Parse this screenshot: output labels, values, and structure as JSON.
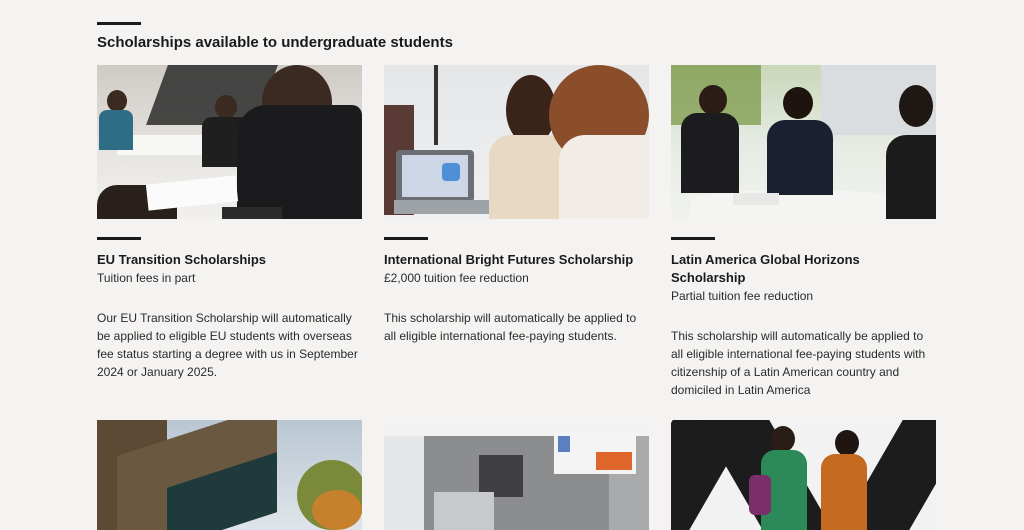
{
  "section": {
    "title": "Scholarships available to undergraduate students"
  },
  "cards": [
    {
      "title": "EU Transition Scholarships",
      "subtitle": "Tuition fees in part",
      "description": "Our EU Transition Scholarship will automatically be applied to eligible EU students with overseas fee status starting a degree with us in September 2024 or January 2025."
    },
    {
      "title": "International Bright Futures Scholarship",
      "subtitle": "£2,000 tuition fee reduction",
      "description": "This scholarship will automatically be applied to all eligible international fee-paying students."
    },
    {
      "title": "Latin America Global Horizons Scholarship",
      "subtitle": "Partial tuition fee reduction",
      "description": "This scholarship will automatically be applied to all eligible international fee-paying students with citizenship of a Latin American country and domiciled in Latin America"
    }
  ],
  "colors": {
    "background": "#f4f3f2",
    "text": "#1a1a1a",
    "rule": "#1a1a1a"
  }
}
